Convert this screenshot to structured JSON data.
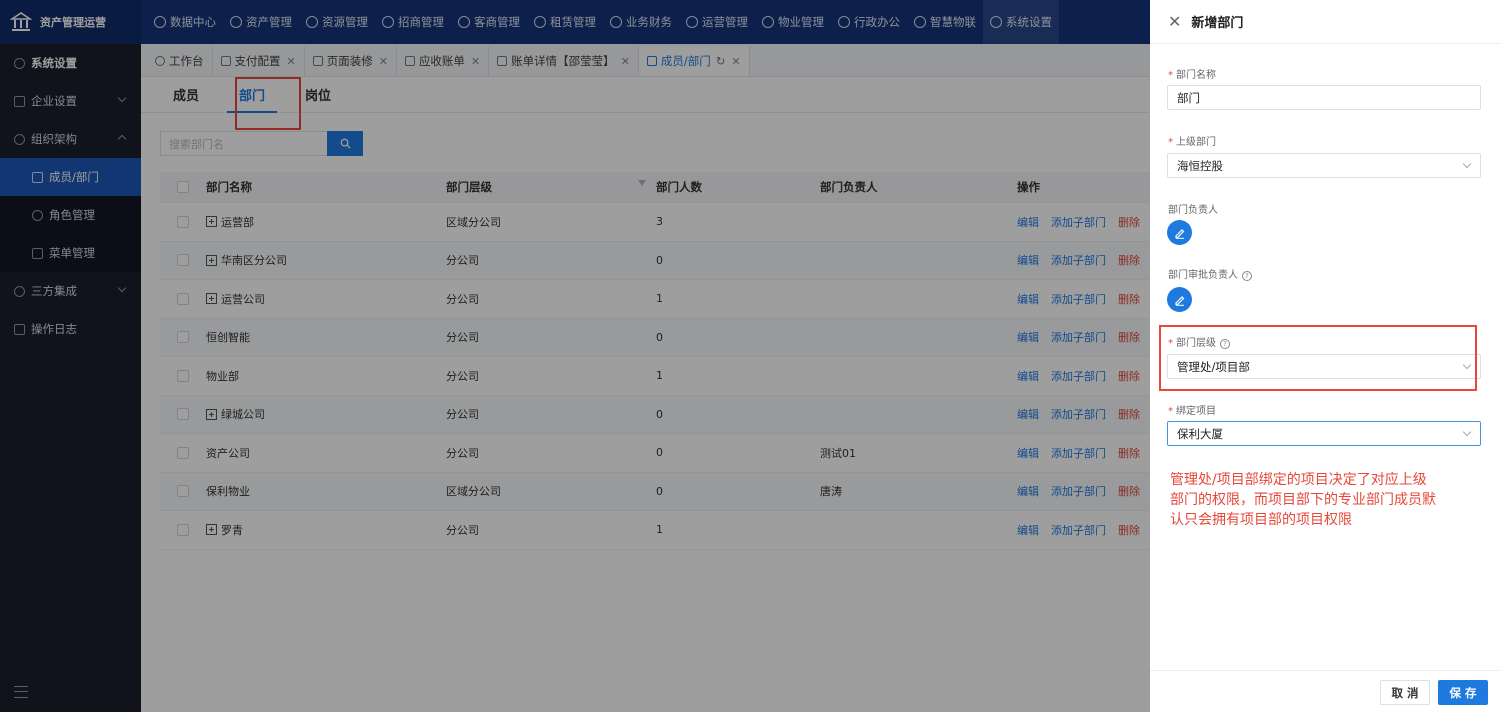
{
  "brand": {
    "name": "资产管理运营",
    "icon": "building-icon"
  },
  "topnav": [
    {
      "label": "数据中心",
      "icon": "clock-icon"
    },
    {
      "label": "资产管理",
      "icon": "cube-icon"
    },
    {
      "label": "资源管理",
      "icon": "grid-icon"
    },
    {
      "label": "招商管理",
      "icon": "diamond-icon"
    },
    {
      "label": "客商管理",
      "icon": "users-icon"
    },
    {
      "label": "租赁管理",
      "icon": "home-icon"
    },
    {
      "label": "业务财务",
      "icon": "coin-icon"
    },
    {
      "label": "运营管理",
      "icon": "chart-icon"
    },
    {
      "label": "物业管理",
      "icon": "building-icon"
    },
    {
      "label": "行政办公",
      "icon": "monitor-icon"
    },
    {
      "label": "智慧物联",
      "icon": "iot-icon"
    },
    {
      "label": "系统设置",
      "icon": "gear-icon"
    }
  ],
  "sidebar": {
    "title": "系统设置",
    "items": [
      {
        "label": "企业设置"
      },
      {
        "label": "组织架构"
      },
      {
        "label": "成员/部门"
      },
      {
        "label": "角色管理"
      },
      {
        "label": "菜单管理"
      },
      {
        "label": "三方集成"
      },
      {
        "label": "操作日志"
      }
    ]
  },
  "tabs": [
    {
      "label": "工作台"
    },
    {
      "label": "支付配置"
    },
    {
      "label": "页面装修"
    },
    {
      "label": "应收账单"
    },
    {
      "label": "账单详情【邵莹莹】"
    },
    {
      "label": "成员/部门"
    }
  ],
  "subtabs": [
    "成员",
    "部门",
    "岗位"
  ],
  "search": {
    "placeholder": "搜索部门名"
  },
  "table": {
    "headers": [
      "部门名称",
      "部门层级",
      "部门人数",
      "部门负责人",
      "操作"
    ],
    "ops": [
      "编辑",
      "添加子部门",
      "删除"
    ],
    "rows": [
      {
        "name": "运营部",
        "level": "区域分公司",
        "count": "3",
        "head": "",
        "expand": true
      },
      {
        "name": "华南区分公司",
        "level": "分公司",
        "count": "0",
        "head": "",
        "expand": true
      },
      {
        "name": "运营公司",
        "level": "分公司",
        "count": "1",
        "head": "",
        "expand": true
      },
      {
        "name": "恒创智能",
        "level": "分公司",
        "count": "0",
        "head": "",
        "expand": false
      },
      {
        "name": "物业部",
        "level": "分公司",
        "count": "1",
        "head": "",
        "expand": false
      },
      {
        "name": "绿城公司",
        "level": "分公司",
        "count": "0",
        "head": "",
        "expand": true
      },
      {
        "name": "资产公司",
        "level": "分公司",
        "count": "0",
        "head": "测试01",
        "expand": false
      },
      {
        "name": "保利物业",
        "level": "区域分公司",
        "count": "0",
        "head": "唐涛",
        "expand": false
      },
      {
        "name": "罗青",
        "level": "分公司",
        "count": "1",
        "head": "",
        "expand": true
      }
    ]
  },
  "drawer": {
    "title": "新增部门",
    "dept_name_label": "部门名称",
    "dept_name_value": "部门",
    "parent_label": "上级部门",
    "parent_value": "海恒控股",
    "head_label": "部门负责人",
    "approver_label": "部门审批负责人",
    "level_label": "部门层级",
    "level_value": "管理处/项目部",
    "project_label": "绑定项目",
    "project_value": "保利大厦",
    "cancel": "取 消",
    "save": "保 存"
  },
  "annotation": "管理处/项目部绑定的项目决定了对应上级部门的权限，而项目部下的专业部门成员默认只会拥有项目部的项目权限",
  "colors": {
    "primary": "#1f7ae0",
    "nav": "#14357a",
    "sidebar": "#1a1f2e",
    "annotation": "#e8473a"
  }
}
